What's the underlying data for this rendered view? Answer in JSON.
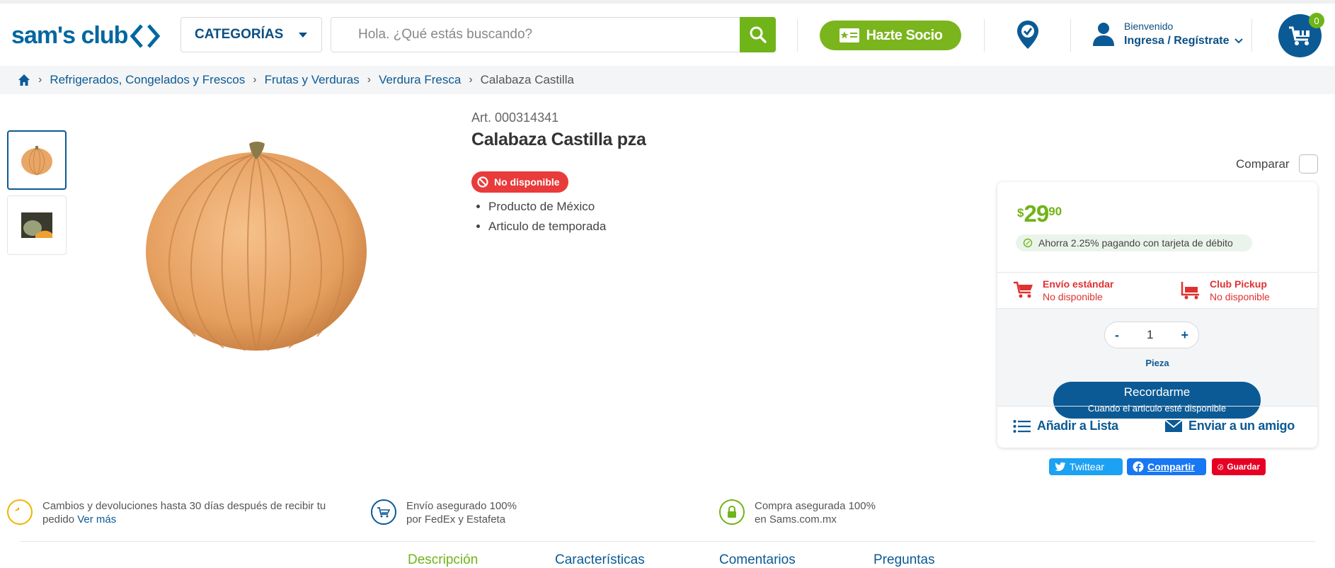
{
  "header": {
    "logo": "sam's club",
    "categories_label": "CATEGORÍAS",
    "search_placeholder": "Hola. ¿Qué estás buscando?",
    "socio_label": "Hazte Socio",
    "welcome": "Bienvenido",
    "login_label": "Ingresa / Regístrate",
    "cart_count": "0"
  },
  "breadcrumb": [
    "Refrigerados, Congelados y Frescos",
    "Frutas y Verduras",
    "Verdura Fresca",
    "Calabaza Castilla"
  ],
  "product": {
    "article": "Art. 000314341",
    "name": "Calabaza Castilla pza",
    "status": "No disponible",
    "features": [
      "Producto de México",
      "Articulo de temporada"
    ],
    "compare_label": "Comparar"
  },
  "buybox": {
    "price_currency": "$",
    "price_int": "29",
    "price_dec": "90",
    "saving": "Ahorra 2.25% pagando con tarjeta de débito",
    "shipping": {
      "title": "Envío estándar",
      "status": "No disponible"
    },
    "pickup": {
      "title": "Club Pickup",
      "status": "No disponible"
    },
    "quantity": "1",
    "qty_minus": "-",
    "qty_plus": "+",
    "unit": "Pieza",
    "remind_title": "Recordarme",
    "remind_sub": "Cuando el articulo esté disponible",
    "add_list": "Añadir a Lista",
    "send_friend": "Enviar a un amigo"
  },
  "social": {
    "twitter": "Twittear",
    "facebook": "Compartir",
    "pinterest": "Guardar"
  },
  "features": {
    "returns_text": "Cambios y devoluciones hasta 30 días después de recibir tu",
    "returns_text2": "pedido",
    "returns_link": "Ver más",
    "shipping_line1": "Envío asegurado 100%",
    "shipping_line2": "por FedEx y Estafeta",
    "purchase_line1": "Compra asegurada 100%",
    "purchase_line2": "en Sams.com.mx"
  },
  "tabs": [
    "Descripción",
    "Características",
    "Comentarios",
    "Preguntas"
  ],
  "colors": {
    "brand_blue": "#0b5a95",
    "green": "#6fb418",
    "red": "#e93b3b"
  }
}
